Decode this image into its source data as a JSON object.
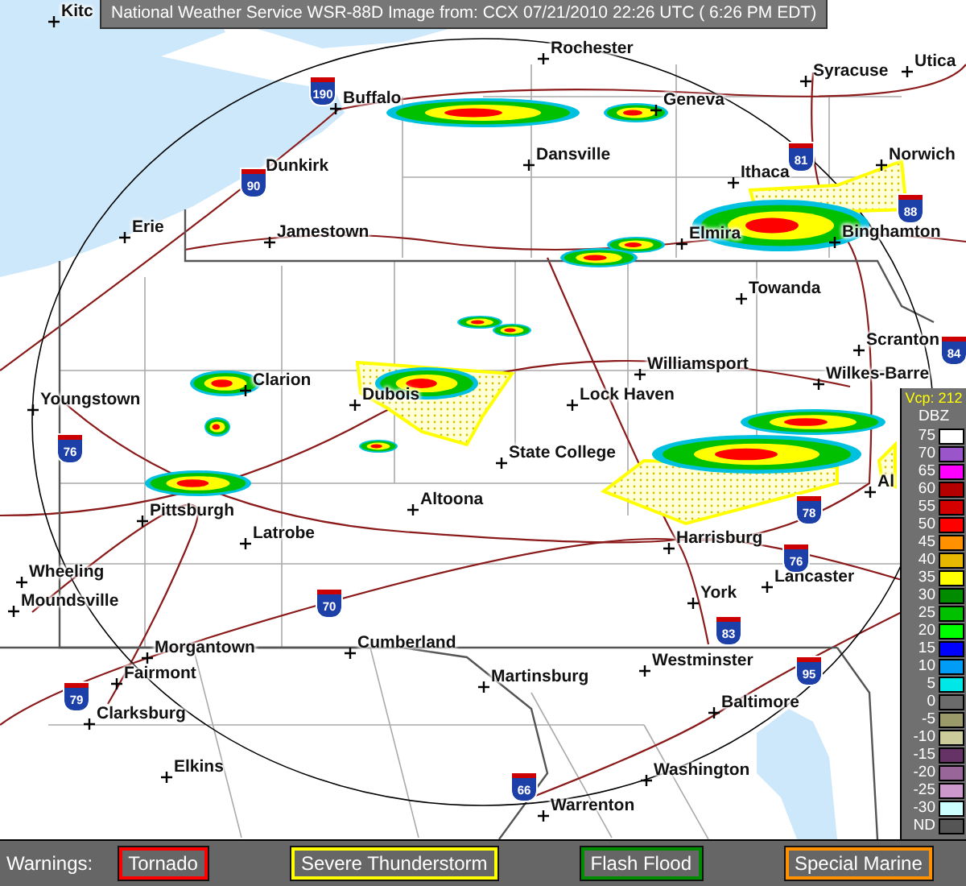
{
  "title": "National Weather Service WSR-88D Image  from:  CCX 07/21/2010 22:26 UTC ( 6:26 PM EDT)",
  "map": {
    "cities": [
      {
        "name": "Kitc"
      },
      {
        "name": "Rochester"
      },
      {
        "name": "Syracuse"
      },
      {
        "name": "Utica"
      },
      {
        "name": "Buffalo"
      },
      {
        "name": "Geneva"
      },
      {
        "name": "Dansville"
      },
      {
        "name": "Norwich"
      },
      {
        "name": "Dunkirk"
      },
      {
        "name": "Ithaca"
      },
      {
        "name": "Erie"
      },
      {
        "name": "Jamestown"
      },
      {
        "name": "Elmira"
      },
      {
        "name": "Binghamton"
      },
      {
        "name": "Towanda"
      },
      {
        "name": "Scranton"
      },
      {
        "name": "Clarion"
      },
      {
        "name": "Wilkes-Barre"
      },
      {
        "name": "Youngstown"
      },
      {
        "name": "Dubois"
      },
      {
        "name": "Lock Haven"
      },
      {
        "name": "Williamsport"
      },
      {
        "name": "State College"
      },
      {
        "name": "Altoona"
      },
      {
        "name": "Pittsburgh"
      },
      {
        "name": "Latrobe"
      },
      {
        "name": "Harrisburg"
      },
      {
        "name": "Wheeling"
      },
      {
        "name": "Lancaster"
      },
      {
        "name": "Moundsville"
      },
      {
        "name": "York"
      },
      {
        "name": "Morgantown"
      },
      {
        "name": "Cumberland"
      },
      {
        "name": "Fairmont"
      },
      {
        "name": "Martinsburg"
      },
      {
        "name": "Westminster"
      },
      {
        "name": "Clarksburg"
      },
      {
        "name": "Baltimore"
      },
      {
        "name": "Elkins"
      },
      {
        "name": "Washington"
      },
      {
        "name": "Warrenton"
      },
      {
        "name": "Al"
      }
    ],
    "interstate_shields": [
      {
        "number": "190"
      },
      {
        "number": "90"
      },
      {
        "number": "81"
      },
      {
        "number": "88"
      },
      {
        "number": "84"
      },
      {
        "number": "76"
      },
      {
        "number": "78"
      },
      {
        "number": "76"
      },
      {
        "number": "70"
      },
      {
        "number": "83"
      },
      {
        "number": "95"
      },
      {
        "number": "79"
      },
      {
        "number": "66"
      }
    ]
  },
  "legend": {
    "vcp": "Vcp: 212",
    "unit": "DBZ",
    "scale": [
      {
        "label": "75",
        "color": "#ffffff"
      },
      {
        "label": "70",
        "color": "#9955c9"
      },
      {
        "label": "65",
        "color": "#ff00ff"
      },
      {
        "label": "60",
        "color": "#b50000"
      },
      {
        "label": "55",
        "color": "#d40000"
      },
      {
        "label": "50",
        "color": "#ff0000"
      },
      {
        "label": "45",
        "color": "#ff9000"
      },
      {
        "label": "40",
        "color": "#e7b800"
      },
      {
        "label": "35",
        "color": "#ffff00"
      },
      {
        "label": "30",
        "color": "#008b00"
      },
      {
        "label": "25",
        "color": "#00c000"
      },
      {
        "label": "20",
        "color": "#00ff00"
      },
      {
        "label": "15",
        "color": "#0000ff"
      },
      {
        "label": "10",
        "color": "#009cf5"
      },
      {
        "label": "5",
        "color": "#00e7e7"
      },
      {
        "label": "0",
        "color": "#6b6b6b"
      },
      {
        "label": "-5",
        "color": "#9a9a6b"
      },
      {
        "label": "-10",
        "color": "#cbcb9b"
      },
      {
        "label": "-15",
        "color": "#663366"
      },
      {
        "label": "-20",
        "color": "#996699"
      },
      {
        "label": "-25",
        "color": "#cc99cc"
      },
      {
        "label": "-30",
        "color": "#ccffff"
      },
      {
        "label": "ND",
        "color": "#555555"
      }
    ]
  },
  "warnings": {
    "label": "Warnings:",
    "items": [
      {
        "name": "Tornado",
        "color": "#ff0000"
      },
      {
        "name": "Severe Thunderstorm",
        "color": "#ffff00"
      },
      {
        "name": "Flash Flood",
        "color": "#008b00"
      },
      {
        "name": "Special Marine",
        "color": "#ff9000"
      }
    ]
  }
}
